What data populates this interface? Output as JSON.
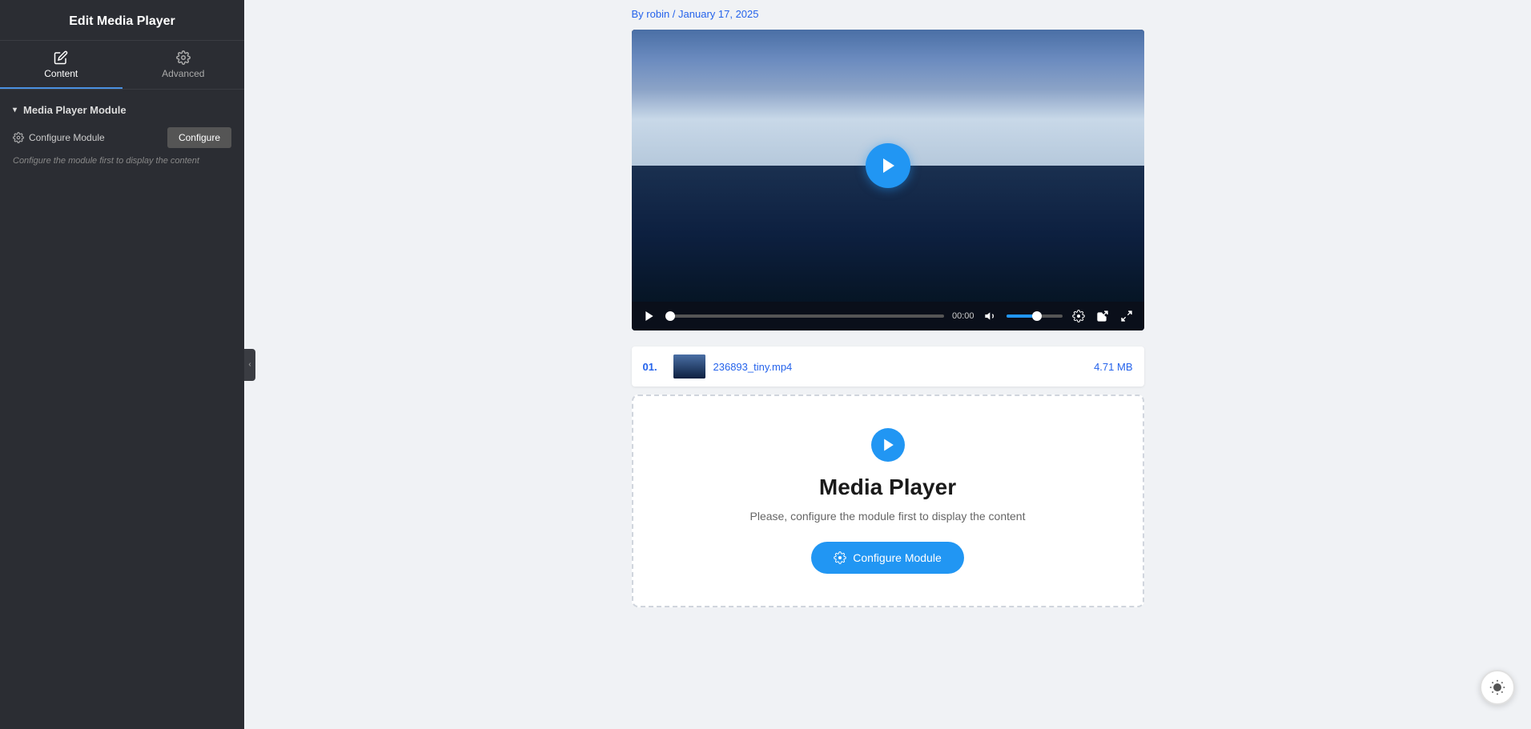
{
  "sidebar": {
    "header": "Edit Media Player",
    "tabs": [
      {
        "id": "content",
        "label": "Content",
        "active": true
      },
      {
        "id": "advanced",
        "label": "Advanced",
        "active": false
      }
    ],
    "section": {
      "title": "Media Player Module",
      "configure_label": "Configure Module",
      "configure_btn": "Configure",
      "hint": "Configure the module first to display the content"
    },
    "collapse_icon": "‹"
  },
  "post_meta": "By robin / January 17, 2025",
  "video": {
    "time": "00:00"
  },
  "playlist": [
    {
      "num": "01.",
      "name": "236893_tiny.mp4",
      "size": "4.71 MB"
    }
  ],
  "media_widget": {
    "title": "Media Player",
    "description": "Please, configure the module first to display the content",
    "btn_label": "Configure Module"
  },
  "icons": {
    "play": "play-icon",
    "gear": "gear-icon",
    "pencil": "pencil-icon",
    "volume": "volume-icon",
    "settings": "settings-icon",
    "external": "external-link-icon",
    "fullscreen": "fullscreen-icon",
    "sun": "sun-icon"
  }
}
